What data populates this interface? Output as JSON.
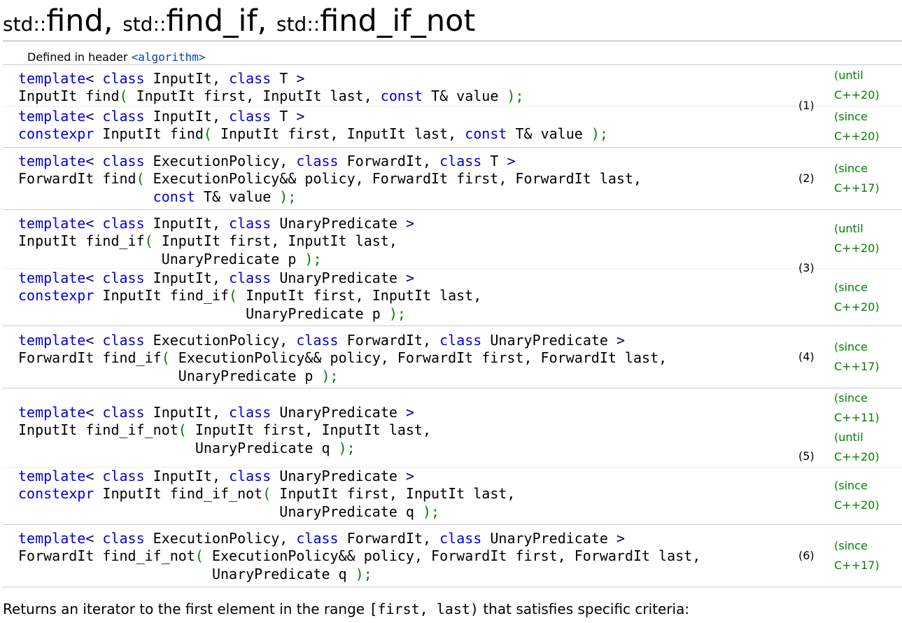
{
  "title": {
    "ns1": "std::",
    "name1": "find",
    "sep1": ", ",
    "ns2": "std::",
    "name2": "find_if",
    "sep2": ", ",
    "ns3": "std::",
    "name3": "find_if_not"
  },
  "defined": {
    "label": "Defined in header ",
    "header": "<algorithm>"
  },
  "overloads": [
    {
      "id": "o1a",
      "lines": [
        "template< class InputIt, class T >",
        "InputIt find( InputIt first, InputIt last, const T& value );"
      ],
      "ver": [
        "(until",
        "C++20)"
      ]
    },
    {
      "id": "o1b",
      "lines": [
        "template< class InputIt, class T >",
        "constexpr InputIt find( InputIt first, InputIt last, const T& value );"
      ],
      "ver": [
        "(since",
        "C++20)"
      ]
    },
    {
      "id": "o2",
      "lines": [
        "template< class ExecutionPolicy, class ForwardIt, class T >",
        "ForwardIt find( ExecutionPolicy&& policy, ForwardIt first, ForwardIt last,",
        "                const T& value );"
      ],
      "ver": [
        "(since",
        "C++17)"
      ]
    },
    {
      "id": "o3a",
      "lines": [
        "template< class InputIt, class UnaryPredicate >",
        "InputIt find_if( InputIt first, InputIt last,",
        "                 UnaryPredicate p );"
      ],
      "ver": [
        "(until",
        "C++20)"
      ]
    },
    {
      "id": "o3b",
      "lines": [
        "template< class InputIt, class UnaryPredicate >",
        "constexpr InputIt find_if( InputIt first, InputIt last,",
        "                           UnaryPredicate p );"
      ],
      "ver": [
        "(since",
        "C++20)"
      ]
    },
    {
      "id": "o4",
      "lines": [
        "template< class ExecutionPolicy, class ForwardIt, class UnaryPredicate >",
        "ForwardIt find_if( ExecutionPolicy&& policy, ForwardIt first, ForwardIt last,",
        "                   UnaryPredicate p );"
      ],
      "ver": [
        "(since",
        "C++17)"
      ]
    },
    {
      "id": "o5a",
      "lines": [
        "template< class InputIt, class UnaryPredicate >",
        "InputIt find_if_not( InputIt first, InputIt last,",
        "                     UnaryPredicate q );"
      ],
      "ver": [
        "(since",
        "C++11)",
        "(until",
        "C++20)"
      ]
    },
    {
      "id": "o5b",
      "lines": [
        "template< class InputIt, class UnaryPredicate >",
        "constexpr InputIt find_if_not( InputIt first, InputIt last,",
        "                               UnaryPredicate q );"
      ],
      "ver": [
        "(since",
        "C++20)"
      ]
    },
    {
      "id": "o6",
      "lines": [
        "template< class ExecutionPolicy, class ForwardIt, class UnaryPredicate >",
        "ForwardIt find_if_not( ExecutionPolicy&& policy, ForwardIt first, ForwardIt last,",
        "                       UnaryPredicate q );"
      ],
      "ver": [
        "(since",
        "C++17)"
      ]
    }
  ],
  "numbers": [
    "(1)",
    "(2)",
    "(3)",
    "(4)",
    "(5)",
    "(6)"
  ],
  "description": {
    "before": "Returns an iterator to the first element in the range ",
    "range": "[first, last)",
    "after": " that satisfies specific criteria:"
  },
  "colors": {
    "keyword": "#0000dd",
    "type_keyword": "#000080",
    "bracket": "#008000",
    "version": "#008000",
    "link": "#0645ad"
  }
}
